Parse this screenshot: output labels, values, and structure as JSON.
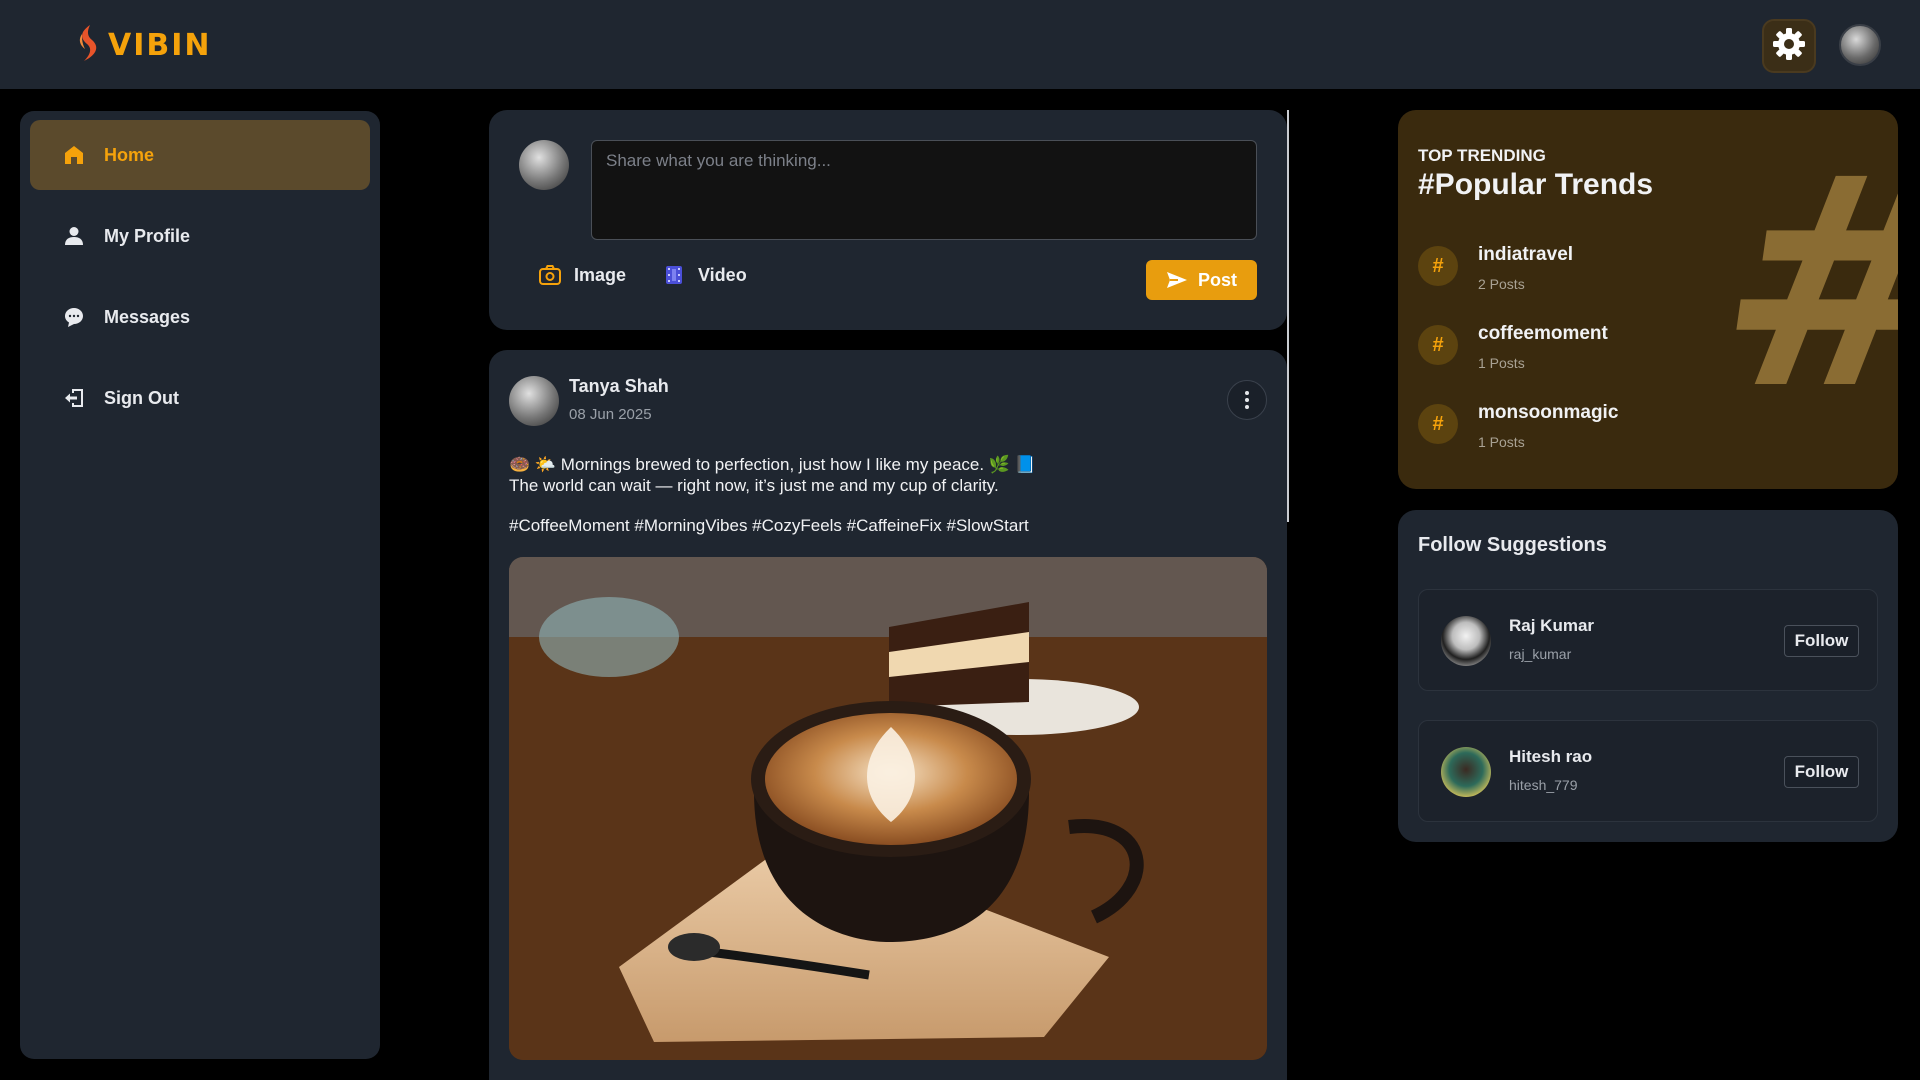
{
  "app": {
    "logo_text": "VIBIN"
  },
  "header": {
    "settings_icon": "gear-icon",
    "avatar_icon": "user-avatar"
  },
  "sidebar": {
    "items": [
      {
        "label": "Home",
        "icon": "home-icon",
        "active": true
      },
      {
        "label": "My Profile",
        "icon": "user-icon",
        "active": false
      },
      {
        "label": "Messages",
        "icon": "chat-icon",
        "active": false
      },
      {
        "label": "Sign Out",
        "icon": "sign-out-icon",
        "active": false
      }
    ]
  },
  "composer": {
    "placeholder": "Share what you are thinking...",
    "image_label": "Image",
    "video_label": "Video",
    "post_label": "Post"
  },
  "post": {
    "author": "Tanya Shah",
    "date": "08 Jun 2025",
    "line1": "🍩 🌤️ Mornings brewed to perfection, just how I like my peace. 🌿 📘",
    "line2": "The world can wait — right now, it’s just me and my cup of clarity.",
    "hashtags": "#CoffeeMoment #MorningVibes #CozyFeels #CaffeineFix #SlowStart"
  },
  "trending": {
    "kicker": "TOP TRENDING",
    "title": "#Popular Trends",
    "items": [
      {
        "tag": "indiatravel",
        "count": "2 Posts"
      },
      {
        "tag": "coffeemoment",
        "count": "1 Posts"
      },
      {
        "tag": "monsoonmagic",
        "count": "1 Posts"
      }
    ]
  },
  "suggestions": {
    "title": "Follow Suggestions",
    "users": [
      {
        "name": "Raj Kumar",
        "handle": "raj_kumar",
        "follow_label": "Follow"
      },
      {
        "name": "Hitesh rao",
        "handle": "hitesh_779",
        "follow_label": "Follow"
      }
    ]
  },
  "colors": {
    "accent": "#f5a20b",
    "panel": "#1f2630",
    "trending_bg": "#3a2a0e",
    "background": "#000000"
  }
}
